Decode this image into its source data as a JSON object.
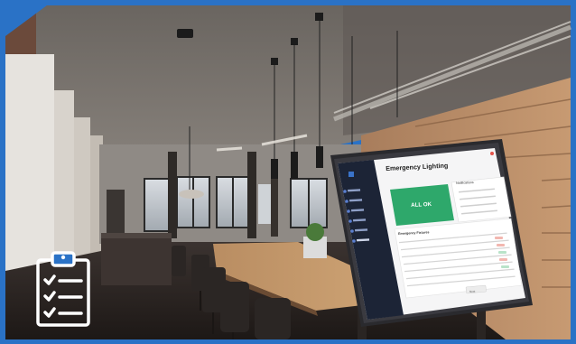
{
  "scene": "office-interior",
  "tablet": {
    "app_title": "Emergency Lighting",
    "status_label": "ALL OK",
    "notifications_label": "Notifications",
    "list_title": "Emergency Fixtures",
    "footer_label": "",
    "footer_button": "Next"
  },
  "colors": {
    "frame": "#2a72c6",
    "status_ok": "#2ea86b",
    "tablet_sidebar": "#1c2436",
    "icon_white": "#ffffff"
  },
  "icons": {
    "clipboard": "clipboard-checklist-icon"
  }
}
